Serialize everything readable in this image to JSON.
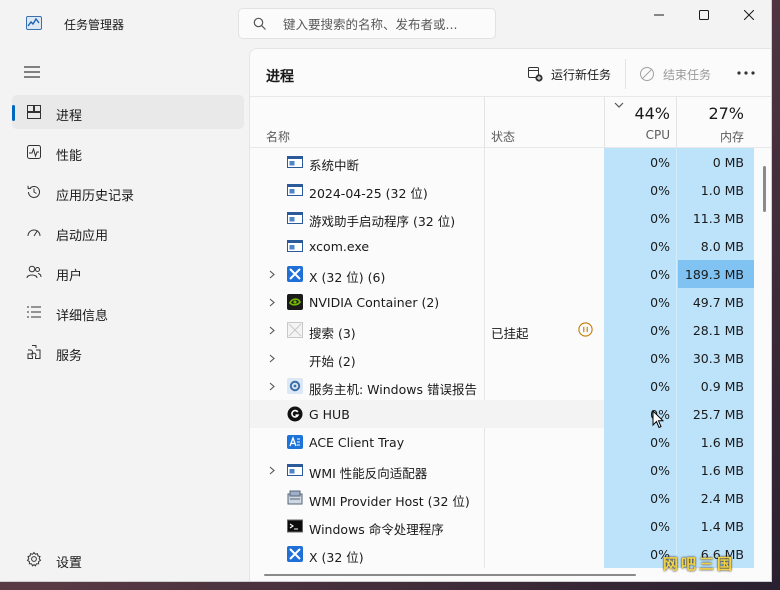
{
  "app": {
    "title": "任务管理器"
  },
  "search": {
    "placeholder": "键入要搜索的名称、发布者或..."
  },
  "sidebar": {
    "items": [
      {
        "label": "进程",
        "icon": "processes-icon",
        "active": true
      },
      {
        "label": "性能",
        "icon": "performance-icon"
      },
      {
        "label": "应用历史记录",
        "icon": "app-history-icon"
      },
      {
        "label": "启动应用",
        "icon": "startup-apps-icon"
      },
      {
        "label": "用户",
        "icon": "users-icon"
      },
      {
        "label": "详细信息",
        "icon": "details-icon"
      },
      {
        "label": "服务",
        "icon": "services-icon"
      }
    ],
    "settings_label": "设置"
  },
  "toolbar": {
    "title": "进程",
    "run_new_task": "运行新任务",
    "end_task": "结束任务"
  },
  "table": {
    "headers": {
      "name": "名称",
      "status": "状态",
      "cpu_percent": "44%",
      "cpu": "CPU",
      "memory_percent": "27%",
      "memory": "内存"
    },
    "rows": [
      {
        "name": "系统中断",
        "status": "",
        "cpu": "0%",
        "memory": "0 MB",
        "icon": "window-app-icon",
        "expandable": false
      },
      {
        "name": "2024-04-25 (32 位)",
        "status": "",
        "cpu": "0%",
        "memory": "1.0 MB",
        "icon": "window-app-icon",
        "expandable": false
      },
      {
        "name": "游戏助手启动程序 (32 位)",
        "status": "",
        "cpu": "0%",
        "memory": "11.3 MB",
        "icon": "window-app-icon",
        "expandable": false
      },
      {
        "name": "xcom.exe",
        "status": "",
        "cpu": "0%",
        "memory": "8.0 MB",
        "icon": "window-app-icon",
        "expandable": false
      },
      {
        "name": "X (32 位) (6)",
        "status": "",
        "cpu": "0%",
        "memory": "189.3 MB",
        "icon": "x-app-icon",
        "expandable": true,
        "memory_high": true
      },
      {
        "name": "NVIDIA Container (2)",
        "status": "",
        "cpu": "0%",
        "memory": "49.7 MB",
        "icon": "nvidia-icon",
        "expandable": true
      },
      {
        "name": "搜索 (3)",
        "status": "已挂起",
        "cpu": "0%",
        "memory": "28.1 MB",
        "icon": "search-app-icon",
        "expandable": true,
        "paused": true
      },
      {
        "name": "开始 (2)",
        "status": "",
        "cpu": "0%",
        "memory": "30.3 MB",
        "icon": "start-icon",
        "expandable": true
      },
      {
        "name": "服务主机: Windows 错误报告",
        "status": "",
        "cpu": "0%",
        "memory": "0.9 MB",
        "icon": "gear-service-icon",
        "expandable": true
      },
      {
        "name": "G HUB",
        "status": "",
        "cpu": "0%",
        "memory": "25.7 MB",
        "icon": "ghub-icon",
        "expandable": false,
        "hover": true
      },
      {
        "name": "ACE Client Tray",
        "status": "",
        "cpu": "0%",
        "memory": "1.6 MB",
        "icon": "ace-icon",
        "expandable": false
      },
      {
        "name": "WMI 性能反向适配器",
        "status": "",
        "cpu": "0%",
        "memory": "1.6 MB",
        "icon": "window-app-icon",
        "expandable": true
      },
      {
        "name": "WMI Provider Host (32 位)",
        "status": "",
        "cpu": "0%",
        "memory": "2.4 MB",
        "icon": "wmi-host-icon",
        "expandable": false
      },
      {
        "name": "Windows 命令处理程序",
        "status": "",
        "cpu": "0%",
        "memory": "1.4 MB",
        "icon": "cmd-icon",
        "expandable": false
      },
      {
        "name": "X (32 位)",
        "status": "",
        "cpu": "0%",
        "memory": "6.6 MB",
        "icon": "x-app-icon",
        "expandable": false
      }
    ]
  },
  "watermark": "网吧三国",
  "colors": {
    "accent": "#0067c0",
    "cpu_column": "#bde3fb",
    "memory_high": "#80c3f3",
    "paused_icon": "#c27b00"
  }
}
